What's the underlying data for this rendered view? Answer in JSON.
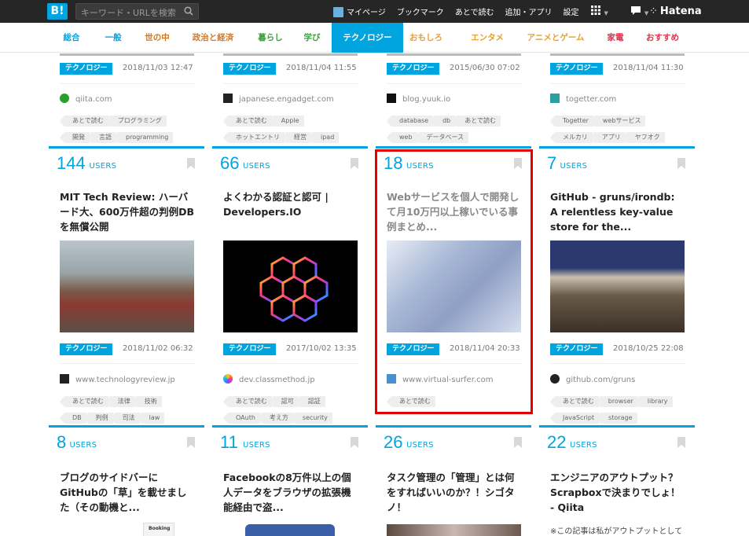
{
  "topbar": {
    "logo": "B!",
    "search_placeholder": "キーワード・URLを検索",
    "links": [
      "マイページ",
      "ブックマーク",
      "あとで読む",
      "追加・アプリ",
      "設定"
    ],
    "brand": "Hatena"
  },
  "categories": [
    {
      "label": "総合",
      "color": "#00a4de"
    },
    {
      "label": "一般",
      "color": "#00a4de"
    },
    {
      "label": "世の中",
      "color": "#d0782c"
    },
    {
      "label": "政治と経済",
      "color": "#d0782c"
    },
    {
      "label": "暮らし",
      "color": "#3ba03b"
    },
    {
      "label": "学び",
      "color": "#3ba03b"
    },
    {
      "label": "テクノロジー",
      "color": "#ffffff"
    },
    {
      "label": "おもしろ",
      "color": "#e8a030"
    },
    {
      "label": "エンタメ",
      "color": "#e8a030"
    },
    {
      "label": "アニメとゲーム",
      "color": "#e8a030"
    },
    {
      "label": "家電",
      "color": "#e0304c"
    },
    {
      "label": "おすすめ",
      "color": "#e0304c"
    }
  ],
  "active_category": "テクノロジー",
  "row0": [
    {
      "category": "テクノロジー",
      "date": "2018/11/03 12:47",
      "domain": "qiita.com",
      "tags1": [
        "あとで読む",
        "プログラミング"
      ],
      "tags2": [
        "開発",
        "言語",
        "programming"
      ]
    },
    {
      "category": "テクノロジー",
      "date": "2018/11/04 11:55",
      "domain": "japanese.engadget.com",
      "tags1": [
        "あとで読む",
        "Apple"
      ],
      "tags2": [
        "ホットエントリ",
        "経営",
        "ipad"
      ]
    },
    {
      "category": "テクノロジー",
      "date": "2015/06/30 07:02",
      "domain": "blog.yuuk.io",
      "tags1": [
        "database",
        "db",
        "あとで読む"
      ],
      "tags2": [
        "web",
        "データベース"
      ]
    },
    {
      "category": "テクノロジー",
      "date": "2018/11/04 11:30",
      "domain": "togetter.com",
      "tags1": [
        "Togetter",
        "webサービス"
      ],
      "tags2": [
        "メルカリ",
        "アプリ",
        "ヤフオク"
      ]
    }
  ],
  "row1": [
    {
      "users": "144",
      "users_label": "USERS",
      "title": "MIT Tech Review: ハーバード大、600万件超の判例DBを無償公開",
      "category": "テクノロジー",
      "date": "2018/11/02 06:32",
      "domain": "www.technologyreview.jp",
      "tags1": [
        "あとで読む",
        "法律",
        "技術"
      ],
      "tags2": [
        "DB",
        "判例",
        "司法",
        "law"
      ]
    },
    {
      "users": "66",
      "users_label": "USERS",
      "title": "よくわかる認証と認可 | Developers.IO",
      "category": "テクノロジー",
      "date": "2017/10/02 13:35",
      "domain": "dev.classmethod.jp",
      "tags1": [
        "あとで読む",
        "認可",
        "認証"
      ],
      "tags2": [
        "OAuth",
        "考え方",
        "security"
      ]
    },
    {
      "users": "18",
      "users_label": "USERS",
      "title": "Webサービスを個人で開発して月10万円以上稼いでいる事例まとめ...",
      "category": "テクノロジー",
      "date": "2018/11/04 20:33",
      "domain": "www.virtual-surfer.com",
      "tags1": [
        "あとで読む"
      ],
      "tags2": []
    },
    {
      "users": "7",
      "users_label": "USERS",
      "title": "GitHub - gruns/irondb: A relentless key-value store for the...",
      "category": "テクノロジー",
      "date": "2018/10/25 22:08",
      "domain": "github.com/gruns",
      "tags1": [
        "あとで読む",
        "browser",
        "library"
      ],
      "tags2": [
        "JavaScript",
        "storage"
      ]
    }
  ],
  "row2": [
    {
      "users": "8",
      "users_label": "USERS",
      "title": "ブログのサイドバーにGitHubの「草」を載せました（その動機と..."
    },
    {
      "users": "11",
      "users_label": "USERS",
      "title": "Facebookの8万件以上の個人データをブラウザの拡張機能経由で盗..."
    },
    {
      "users": "26",
      "users_label": "USERS",
      "title": "タスク管理の「管理」とは何をすればいいのか？！シゴタノ！"
    },
    {
      "users": "22",
      "users_label": "USERS",
      "title": "エンジニアのアウトプット？Scrapboxで決まりでしょ！ - Qiita",
      "excerpt": "※この記事は私がアウトプットとして"
    }
  ],
  "thumb_text": "Booking"
}
